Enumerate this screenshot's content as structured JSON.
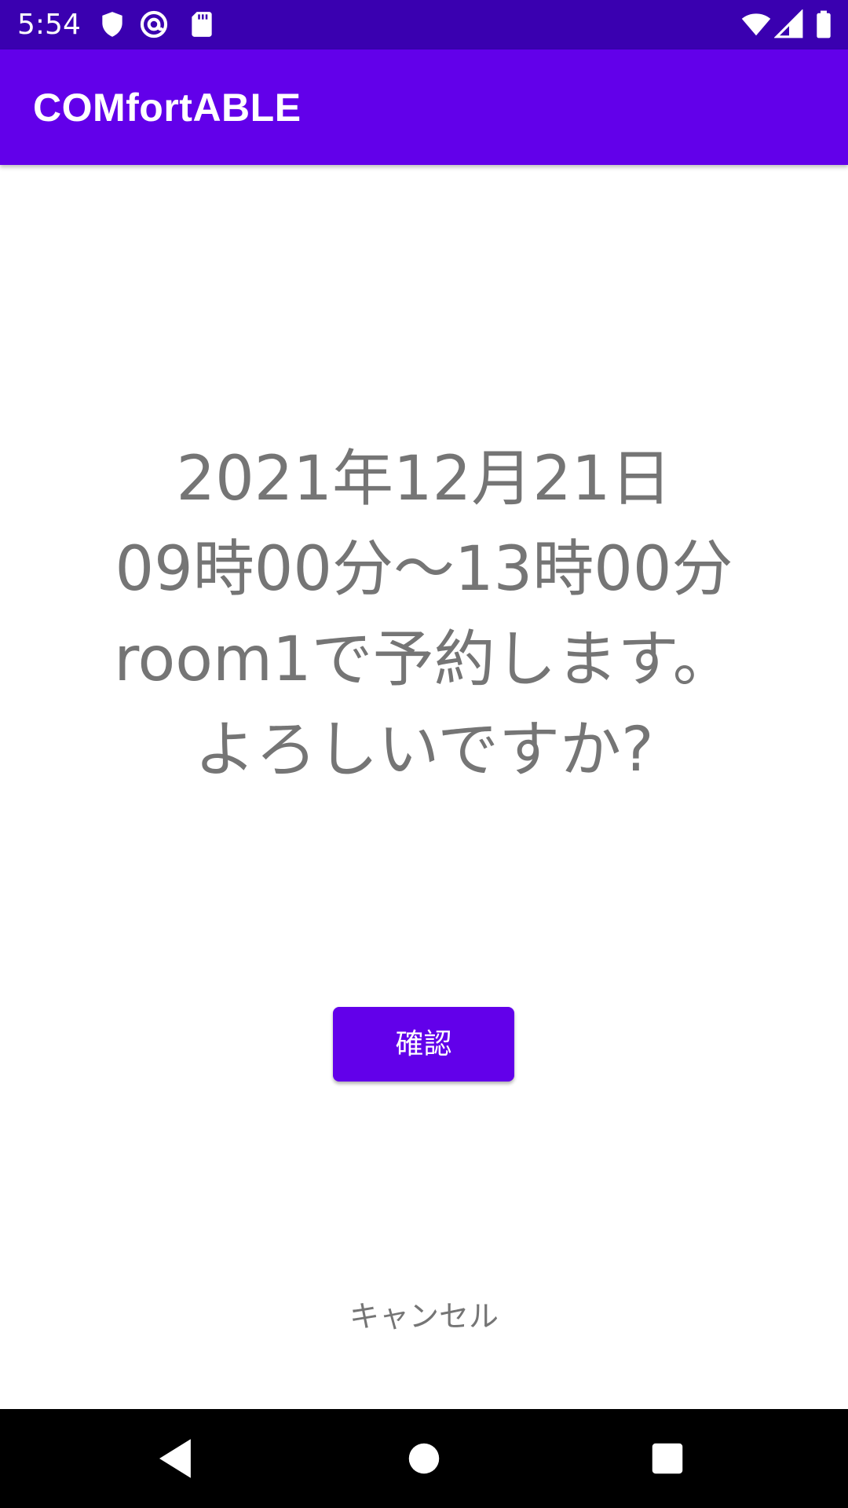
{
  "status_bar": {
    "time": "5:54",
    "left_icons": [
      "shield-icon",
      "at-sign-icon",
      "sd-card-icon"
    ],
    "right_icons": [
      "wifi-icon",
      "cell-signal-icon",
      "battery-icon"
    ]
  },
  "app_bar": {
    "title": "COMfortABLE"
  },
  "confirmation": {
    "lines": [
      "2021年12月21日",
      "09時00分～13時00分",
      "room1で予約します。",
      "よろしいですか?"
    ]
  },
  "actions": {
    "confirm_label": "確認",
    "cancel_label": "キャンセル"
  },
  "nav_bar": {
    "buttons": [
      "back-icon",
      "home-icon",
      "recents-icon"
    ]
  },
  "colors": {
    "status_bar": "#3a00b0",
    "primary": "#6200ea",
    "message_text": "#757575",
    "nav_bar": "#000000"
  }
}
